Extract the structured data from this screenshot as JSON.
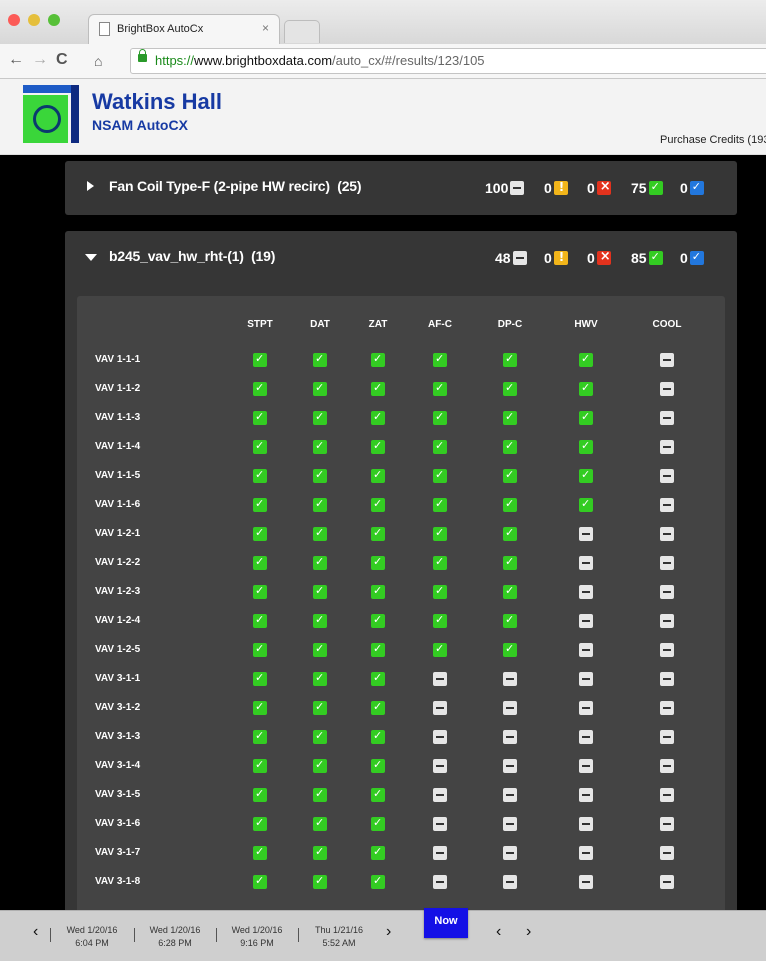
{
  "browser": {
    "tab_title": "BrightBox AutoCx",
    "tab_close": "×",
    "url_scheme": "https://",
    "url_host": "www.brightboxdata.com",
    "url_path": "/auto_cx/#/results/123/105",
    "traffic_lights": [
      "#fc5b57",
      "#e5bf3c",
      "#57c038"
    ]
  },
  "header": {
    "building_name": "Watkins Hall",
    "project_name": "NSAM AutoCX",
    "purchase_credits": "Purchase Credits (193"
  },
  "panels": [
    {
      "title": "Fan Coil Type-F (2-pipe HW recirc)",
      "count": "(25)",
      "expanded": false,
      "counts": {
        "na": "100",
        "warning": "0",
        "fail": "0",
        "pass": "75",
        "info": "0"
      }
    },
    {
      "title": "b245_vav_hw_rht-(1)",
      "count": "(19)",
      "expanded": true,
      "counts": {
        "na": "48",
        "warning": "0",
        "fail": "0",
        "pass": "85",
        "info": "0"
      }
    }
  ],
  "grid": {
    "columns": [
      "STPT",
      "DAT",
      "ZAT",
      "AF-C",
      "DP-C",
      "HWV",
      "COOL"
    ],
    "rows": [
      {
        "label": "VAV 1-1-1",
        "cells": [
          "pass",
          "pass",
          "pass",
          "pass",
          "pass",
          "pass",
          "na"
        ]
      },
      {
        "label": "VAV 1-1-2",
        "cells": [
          "pass",
          "pass",
          "pass",
          "pass",
          "pass",
          "pass",
          "na"
        ]
      },
      {
        "label": "VAV 1-1-3",
        "cells": [
          "pass",
          "pass",
          "pass",
          "pass",
          "pass",
          "pass",
          "na"
        ]
      },
      {
        "label": "VAV 1-1-4",
        "cells": [
          "pass",
          "pass",
          "pass",
          "pass",
          "pass",
          "pass",
          "na"
        ]
      },
      {
        "label": "VAV 1-1-5",
        "cells": [
          "pass",
          "pass",
          "pass",
          "pass",
          "pass",
          "pass",
          "na"
        ]
      },
      {
        "label": "VAV 1-1-6",
        "cells": [
          "pass",
          "pass",
          "pass",
          "pass",
          "pass",
          "pass",
          "na"
        ]
      },
      {
        "label": "VAV 1-2-1",
        "cells": [
          "pass",
          "pass",
          "pass",
          "pass",
          "pass",
          "na",
          "na"
        ]
      },
      {
        "label": "VAV 1-2-2",
        "cells": [
          "pass",
          "pass",
          "pass",
          "pass",
          "pass",
          "na",
          "na"
        ]
      },
      {
        "label": "VAV 1-2-3",
        "cells": [
          "pass",
          "pass",
          "pass",
          "pass",
          "pass",
          "na",
          "na"
        ]
      },
      {
        "label": "VAV 1-2-4",
        "cells": [
          "pass",
          "pass",
          "pass",
          "pass",
          "pass",
          "na",
          "na"
        ]
      },
      {
        "label": "VAV 1-2-5",
        "cells": [
          "pass",
          "pass",
          "pass",
          "pass",
          "pass",
          "na",
          "na"
        ]
      },
      {
        "label": "VAV 3-1-1",
        "cells": [
          "pass",
          "pass",
          "pass",
          "na",
          "na",
          "na",
          "na"
        ]
      },
      {
        "label": "VAV 3-1-2",
        "cells": [
          "pass",
          "pass",
          "pass",
          "na",
          "na",
          "na",
          "na"
        ]
      },
      {
        "label": "VAV 3-1-3",
        "cells": [
          "pass",
          "pass",
          "pass",
          "na",
          "na",
          "na",
          "na"
        ]
      },
      {
        "label": "VAV 3-1-4",
        "cells": [
          "pass",
          "pass",
          "pass",
          "na",
          "na",
          "na",
          "na"
        ]
      },
      {
        "label": "VAV 3-1-5",
        "cells": [
          "pass",
          "pass",
          "pass",
          "na",
          "na",
          "na",
          "na"
        ]
      },
      {
        "label": "VAV 3-1-6",
        "cells": [
          "pass",
          "pass",
          "pass",
          "na",
          "na",
          "na",
          "na"
        ]
      },
      {
        "label": "VAV 3-1-7",
        "cells": [
          "pass",
          "pass",
          "pass",
          "na",
          "na",
          "na",
          "na"
        ]
      },
      {
        "label": "VAV 3-1-8",
        "cells": [
          "pass",
          "pass",
          "pass",
          "na",
          "na",
          "na",
          "na"
        ]
      }
    ]
  },
  "timeline": {
    "items": [
      {
        "date": "Wed 1/20/16",
        "time": "6:04 PM"
      },
      {
        "date": "Wed 1/20/16",
        "time": "6:28 PM"
      },
      {
        "date": "Wed 1/20/16",
        "time": "9:16 PM"
      },
      {
        "date": "Thu 1/21/16",
        "time": "5:52 AM"
      }
    ],
    "now_label": "Now",
    "prev_glyph": "‹",
    "next_glyph": "›"
  },
  "colors": {
    "pass": "#33cc22",
    "na": "#e6e6e6",
    "warning": "#f2b51a",
    "fail": "#e3321d",
    "info": "#2277dd",
    "brand_blue": "#173aa3",
    "now_button": "#1410e6"
  }
}
